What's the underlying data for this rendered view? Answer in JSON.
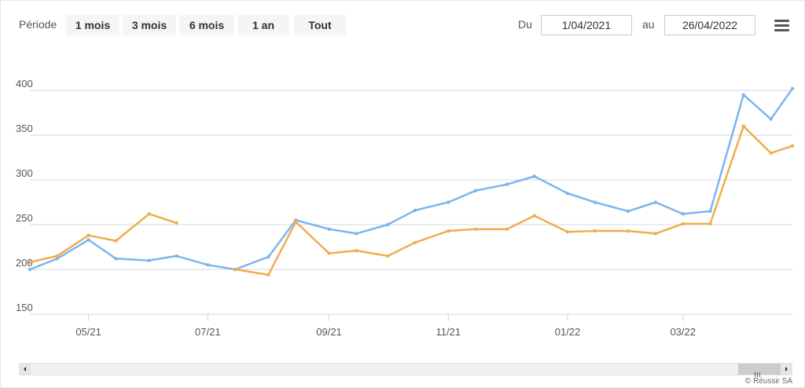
{
  "toolbar": {
    "period_label": "Période",
    "buttons": [
      "1 mois",
      "3 mois",
      "6 mois",
      "1 an",
      "Tout"
    ],
    "from_label": "Du",
    "from_date": "1/04/2021",
    "to_label": "au",
    "to_date": "26/04/2022",
    "menu_icon": "hamburger-menu-icon"
  },
  "credits": "© Réussir SA",
  "chart_data": {
    "type": "line",
    "x": [
      "2021-04-01",
      "2021-04-15",
      "2021-05-01",
      "2021-05-15",
      "2021-06-01",
      "2021-06-15",
      "2021-07-01",
      "2021-07-15",
      "2021-08-01",
      "2021-08-15",
      "2021-09-01",
      "2021-09-15",
      "2021-10-01",
      "2021-10-15",
      "2021-11-01",
      "2021-11-15",
      "2021-12-01",
      "2021-12-15",
      "2022-01-01",
      "2022-01-15",
      "2022-02-01",
      "2022-02-15",
      "2022-03-01",
      "2022-03-15",
      "2022-04-01",
      "2022-04-15",
      "2022-04-26"
    ],
    "series": [
      {
        "name": "",
        "color": "#7cb5ec",
        "values": [
          200,
          212,
          233,
          212,
          210,
          215,
          205,
          200,
          214,
          255,
          245,
          240,
          250,
          266,
          275,
          288,
          295,
          304,
          285,
          275,
          265,
          275,
          262,
          265,
          395,
          368,
          402
        ]
      },
      {
        "name": "",
        "color": "#f0ad4e",
        "values": [
          208,
          215,
          238,
          232,
          262,
          252,
          null,
          200,
          194,
          253,
          218,
          221,
          215,
          230,
          243,
          245,
          245,
          260,
          242,
          243,
          243,
          240,
          251,
          251,
          360,
          330,
          338
        ]
      }
    ],
    "xticks": [
      {
        "date": "2021-05-01",
        "label": "05/21"
      },
      {
        "date": "2021-07-01",
        "label": "07/21"
      },
      {
        "date": "2021-09-01",
        "label": "09/21"
      },
      {
        "date": "2021-11-01",
        "label": "11/21"
      },
      {
        "date": "2022-01-01",
        "label": "01/22"
      },
      {
        "date": "2022-03-01",
        "label": "03/22"
      }
    ],
    "yticks": [
      150,
      200,
      250,
      300,
      350,
      400
    ],
    "ylim": [
      150,
      415
    ],
    "xlim": [
      "2021-04-01",
      "2022-04-26"
    ],
    "grid": true
  }
}
